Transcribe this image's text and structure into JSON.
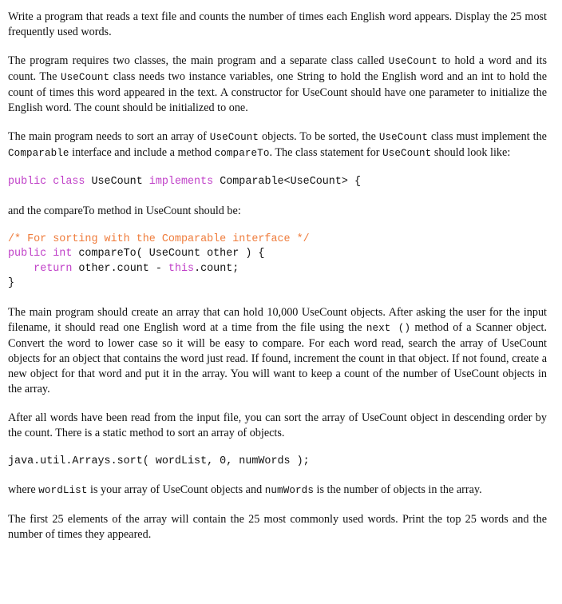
{
  "document": {
    "blocks": [
      {
        "id": "intro",
        "type": "paragraph",
        "text": "Write a program that reads a text file and counts the number of times each English word appears.  Display the 25 most frequently used words."
      },
      {
        "id": "classes",
        "type": "paragraph-rich",
        "runs": [
          {
            "style": "serif",
            "text": "The program requires two classes, the main program and a separate class called "
          },
          {
            "style": "mono",
            "text": "UseCount"
          },
          {
            "style": "serif",
            "text": " to hold a word and its count.  The "
          },
          {
            "style": "mono",
            "text": "UseCount"
          },
          {
            "style": "serif",
            "text": " class needs two instance variables, one String to hold the English word and an int to hold the count of times this word appeared in the text.  A constructor for UseCount should have one parameter to initialize the English word.  The count should be initialized to one."
          }
        ]
      },
      {
        "id": "sorting",
        "type": "paragraph-rich",
        "runs": [
          {
            "style": "serif",
            "text": "The main program needs to sort an array of "
          },
          {
            "style": "mono",
            "text": "UseCount"
          },
          {
            "style": "serif",
            "text": " objects.  To be sorted, the "
          },
          {
            "style": "mono",
            "text": "UseCount"
          },
          {
            "style": "serif",
            "text": " class must implement the "
          },
          {
            "style": "mono",
            "text": "Comparable"
          },
          {
            "style": "serif",
            "text": " interface and include a method "
          },
          {
            "style": "mono",
            "text": "compareTo"
          },
          {
            "style": "serif",
            "text": ".  The class statement for "
          },
          {
            "style": "mono",
            "text": "UseCount"
          },
          {
            "style": "serif",
            "text": " should look like:"
          }
        ]
      },
      {
        "id": "code-class-decl",
        "type": "code",
        "lines": [
          [
            {
              "token": "kw",
              "text": "public class"
            },
            {
              "token": "pln",
              "text": " UseCount "
            },
            {
              "token": "kw",
              "text": "implements"
            },
            {
              "token": "pln",
              "text": " Comparable<UseCount> {"
            }
          ]
        ]
      },
      {
        "id": "compareto-lead",
        "type": "paragraph",
        "text": "and the compareTo method in UseCount should be:"
      },
      {
        "id": "code-compareto",
        "type": "code",
        "lines": [
          [
            {
              "token": "cmt",
              "text": "/* For sorting with the Comparable interface */"
            }
          ],
          [
            {
              "token": "kw",
              "text": "public int"
            },
            {
              "token": "pln",
              "text": " compareTo( UseCount other ) {"
            }
          ],
          [
            {
              "token": "pln",
              "text": "    "
            },
            {
              "token": "kw",
              "text": "return"
            },
            {
              "token": "pln",
              "text": " other.count - "
            },
            {
              "token": "kw",
              "text": "this"
            },
            {
              "token": "pln",
              "text": ".count;"
            }
          ],
          [
            {
              "token": "pln",
              "text": "}"
            }
          ]
        ]
      },
      {
        "id": "main-program",
        "type": "paragraph-rich",
        "runs": [
          {
            "style": "serif",
            "text": "The main program should create an array that can hold 10,000 UseCount objects.  After asking the user for the input filename, it should read one English word at a time from the file using the "
          },
          {
            "style": "mono",
            "text": "next ()"
          },
          {
            "style": "serif",
            "text": " method of a Scanner object.  Convert the word to lower case so it will be easy to compare.  For each word read, search the array of UseCount objects for an object that contains the word just read.  If found, increment the count in that object.  If not found, create a new object for that word and put it in the array.  You will want to keep a count of the number of UseCount objects in the array."
          }
        ]
      },
      {
        "id": "after-read",
        "type": "paragraph",
        "text": "After all words have been read from the input file, you can sort the array of UseCount object in descending order by the count.  There is a static method to sort an array of objects."
      },
      {
        "id": "code-arrays-sort",
        "type": "code",
        "lines": [
          [
            {
              "token": "pln",
              "text": "java.util.Arrays.sort( wordList, 0, numWords );"
            }
          ]
        ]
      },
      {
        "id": "where-clause",
        "type": "paragraph-rich",
        "runs": [
          {
            "style": "serif",
            "text": "where "
          },
          {
            "style": "mono",
            "text": "wordList"
          },
          {
            "style": "serif",
            "text": " is your array of UseCount objects and "
          },
          {
            "style": "mono",
            "text": "numWords"
          },
          {
            "style": "serif",
            "text": " is the number of objects in the array."
          }
        ]
      },
      {
        "id": "closing",
        "type": "paragraph",
        "text": "The first 25 elements of the array will contain the 25 most commonly used words.  Print the top 25 words and the number of times they appeared."
      }
    ]
  },
  "colors": {
    "text": "#111111",
    "keyword": "#c040c8",
    "comment": "#ef7c3c",
    "code_plain": "#111111",
    "background": "#ffffff"
  }
}
